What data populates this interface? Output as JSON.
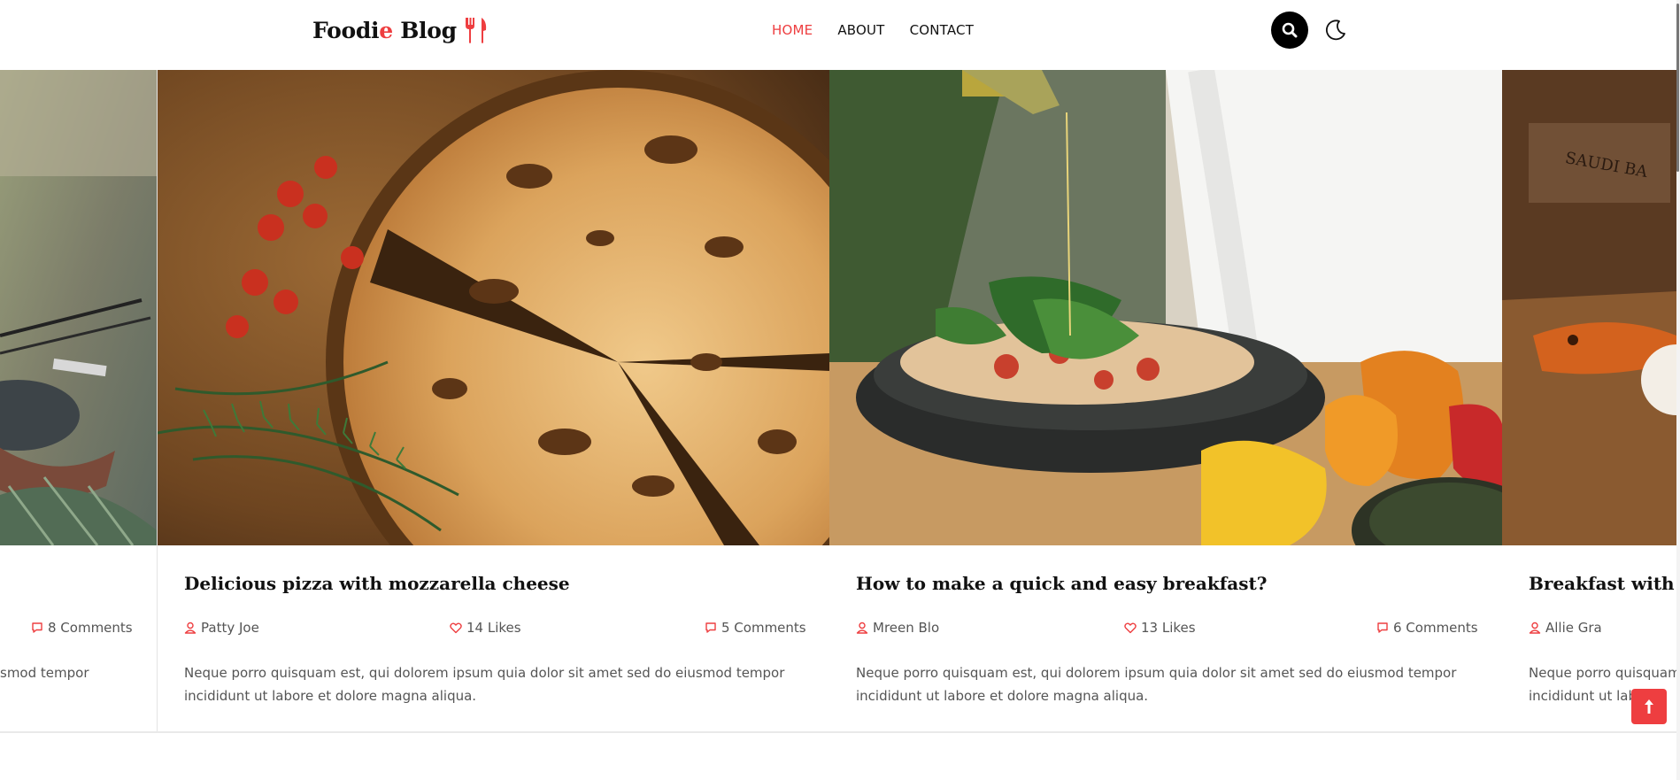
{
  "header": {
    "logo_part1": "Foodi",
    "logo_accent": "e",
    "logo_part2": " Blog",
    "nav": [
      {
        "label": "HOME"
      },
      {
        "label": "ABOUT"
      },
      {
        "label": "CONTACT"
      }
    ]
  },
  "posts": [
    {
      "title": "",
      "comments": "8 Comments",
      "excerpt_line1": "smod tempor",
      "excerpt_line2": ""
    },
    {
      "title": "Delicious pizza with mozzarella cheese",
      "author": "Patty Joe",
      "likes": "14 Likes",
      "comments": "5 Comments",
      "excerpt_line1": "Neque porro quisquam est, qui dolorem ipsum quia dolor sit amet sed do eiusmod tempor",
      "excerpt_line2": "incididunt ut labore et dolore magna aliqua."
    },
    {
      "title": "How to make a quick and easy breakfast?",
      "author": "Mreen Blo",
      "likes": "13 Likes",
      "comments": "6 Comments",
      "excerpt_line1": "Neque porro quisquam est, qui dolorem ipsum quia dolor sit amet sed do eiusmod tempor",
      "excerpt_line2": "incididunt ut labore et dolore magna aliqua."
    },
    {
      "title": "Breakfast with Bu",
      "author": "Allie Gra",
      "excerpt_line1": "Neque porro quisquam",
      "excerpt_line2": "incididunt ut lab"
    }
  ],
  "colors": {
    "accent": "#ee3e40",
    "text": "#111111",
    "muted": "#555555"
  },
  "icons": {
    "search": "search-icon",
    "theme": "moon-icon",
    "author": "user-icon",
    "likes": "heart-icon",
    "comments": "comment-icon",
    "back_to_top": "arrow-up-icon"
  }
}
